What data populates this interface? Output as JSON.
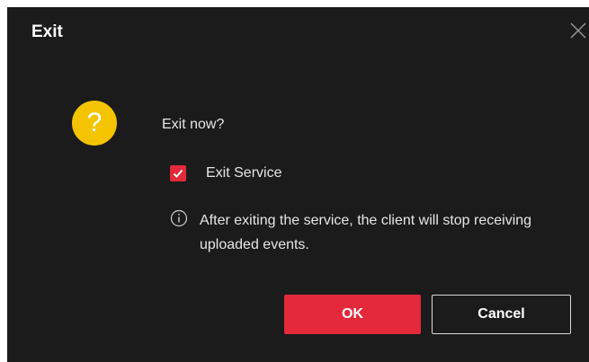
{
  "dialog": {
    "title": "Exit",
    "close_icon": "close-icon",
    "question_icon": "question-icon",
    "question_glyph": "?",
    "message": "Exit now?",
    "checkbox": {
      "label": "Exit Service",
      "checked": true
    },
    "info_icon": "info-icon",
    "info_text": "After exiting the service, the client will stop receiving uploaded events.",
    "ok_label": "OK",
    "cancel_label": "Cancel"
  },
  "colors": {
    "background": "#1b1b1b",
    "accent": "#e4293a",
    "question_icon": "#f5c400",
    "text": "#e6e6e6"
  }
}
